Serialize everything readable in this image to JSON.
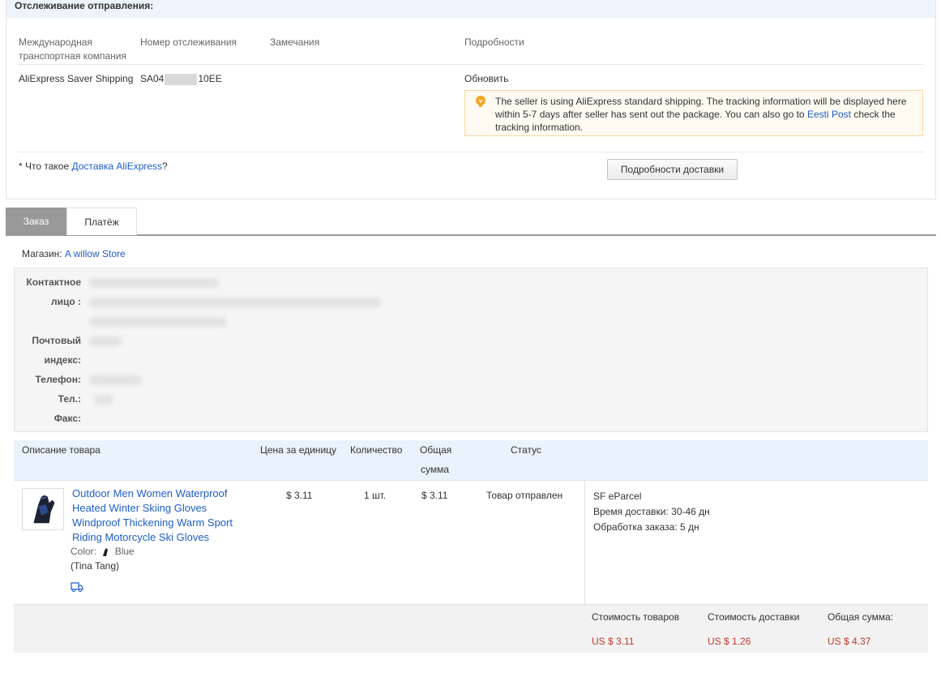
{
  "tracking": {
    "title": "Отслеживание отправления:",
    "headers": {
      "company": "Международная транспортная компания",
      "number": "Номер отслеживания",
      "remarks": "Замечания",
      "details": "Подробности"
    },
    "company": "AliExpress Saver Shipping",
    "number_prefix": "SA04",
    "number_suffix": "10EE",
    "refresh_link": "Обновить",
    "notice_text": "The seller is using AliExpress standard shipping. The tracking information will be displayed here within 5-7 days after seller has sent out the package. You can also go to",
    "notice_link": "Eesti Post",
    "notice_tail": "check the tracking information.",
    "whatis_prefix": "* Что такое",
    "whatis_link": "Доставка AliExpress",
    "whatis_suffix": "?",
    "details_button": "Подробности доставки"
  },
  "tabs": [
    {
      "label": "Заказ",
      "active": true
    },
    {
      "label": "Платёж",
      "active": false
    }
  ],
  "store": {
    "label": "Магазин:",
    "name": "A willow Store"
  },
  "contact": {
    "contact_label_1": "Контактное",
    "contact_label_2": "лицо :",
    "zip_label_1": "Почтовый",
    "zip_label_2": "индекс:",
    "phone_label": "Телефон:",
    "tel_label": "Тел.:",
    "fax_label": "Факс:"
  },
  "product_table": {
    "headers": {
      "description": "Описание товара",
      "unit_price": "Цена за единицу",
      "quantity": "Количество",
      "total_1": "Общая",
      "total_2": "сумма",
      "status": "Статус"
    },
    "item": {
      "title": "Outdoor Men Women Waterproof Heated Winter Skiing Gloves Windproof Thickening Warm Sport Riding Motorcycle Ski Gloves",
      "color_label": "Color:",
      "color_value": "Blue",
      "seller": "(Tina Tang)",
      "unit_price": "$ 3.11",
      "quantity": "1 шт.",
      "total": "$ 3.11",
      "status": "Товар отправлен",
      "shipping_method": "SF eParcel",
      "delivery_time_label": "Время доставки:",
      "delivery_time": "30-46 дн",
      "processing_label": "Обработка заказа:",
      "processing_time": "5 дн"
    },
    "footer": {
      "goods_label": "Стоимость товаров",
      "goods_value": "US $ 3.11",
      "shipping_label": "Стоимость доставки",
      "shipping_value": "US $ 1.26",
      "total_label": "Общая сумма:",
      "total_value": "US $ 4.37"
    }
  },
  "colors": {
    "link": "#1e5ec8",
    "price": "#c0392b",
    "header_bg": "#eaf2fb",
    "tab_active": "#999999"
  }
}
